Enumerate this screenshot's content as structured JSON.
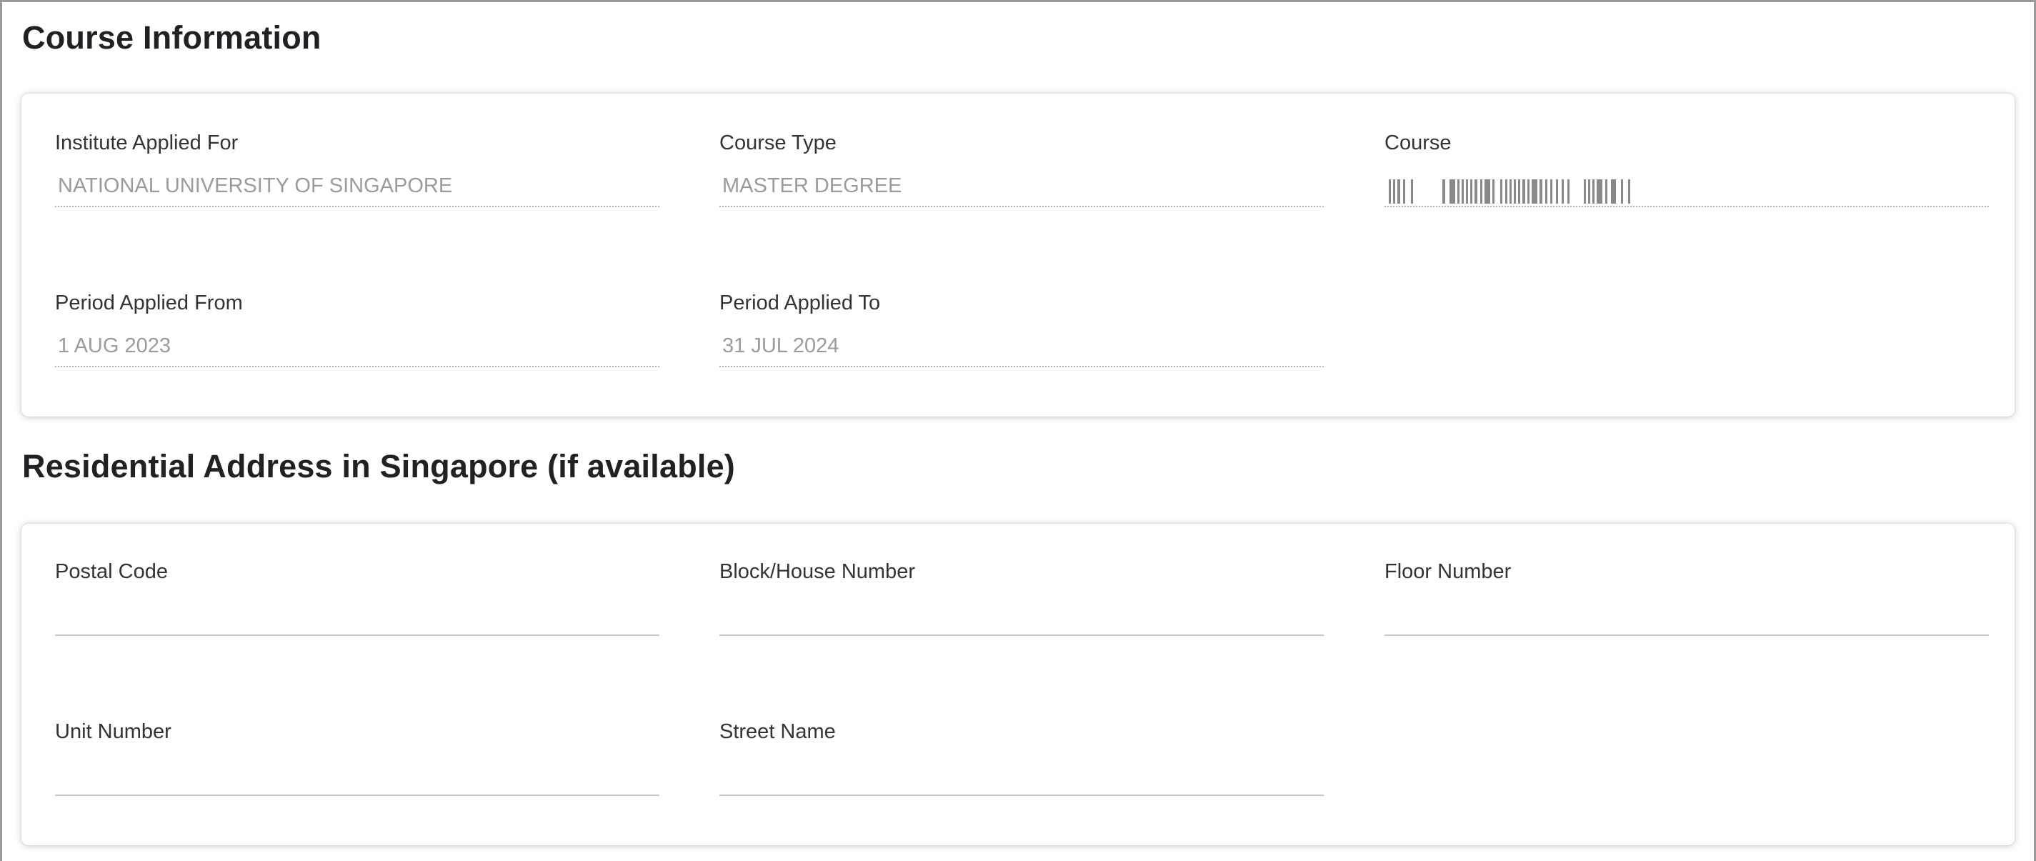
{
  "course_section": {
    "title": "Course Information",
    "fields": {
      "institute": {
        "label": "Institute Applied For",
        "value": "NATIONAL UNIVERSITY OF SINGAPORE"
      },
      "course_type": {
        "label": "Course Type",
        "value": "MASTER DEGREE"
      },
      "course": {
        "label": "Course",
        "value": ""
      },
      "period_from": {
        "label": "Period Applied From",
        "value": "1 AUG 2023"
      },
      "period_to": {
        "label": "Period Applied To",
        "value": "31 JUL 2024"
      }
    }
  },
  "address_section": {
    "title": "Residential Address in Singapore (if available)",
    "fields": {
      "postal_code": {
        "label": "Postal Code",
        "value": ""
      },
      "block_house": {
        "label": "Block/House Number",
        "value": ""
      },
      "floor": {
        "label": "Floor Number",
        "value": ""
      },
      "unit": {
        "label": "Unit Number",
        "value": ""
      },
      "street": {
        "label": "Street Name",
        "value": ""
      }
    }
  },
  "colors": {
    "readonly_text": "#9b9b9b",
    "label_text": "#333333",
    "heading_text": "#202124",
    "frame_border": "#9a9a9a"
  }
}
